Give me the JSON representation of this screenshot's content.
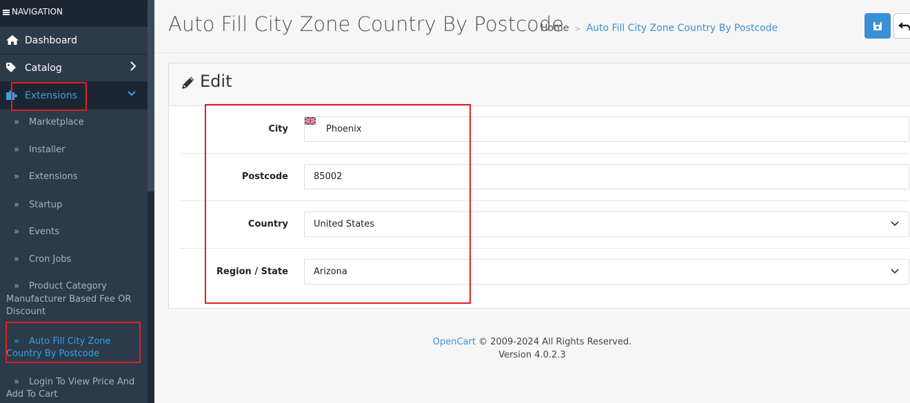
{
  "nav": {
    "header": "NAVIGATION",
    "items": [
      {
        "label": "Dashboard",
        "icon": "home-icon"
      },
      {
        "label": "Catalog",
        "icon": "tag-icon"
      },
      {
        "label": "Extensions",
        "icon": "puzzle-icon"
      }
    ],
    "submenu": [
      "Marketplace",
      "Installer",
      "Extensions",
      "Startup",
      "Events",
      "Cron Jobs",
      "Product Category Manufacturer Based Fee OR Discount",
      "Auto Fill City Zone Country By Postcode",
      "Login To View Price And Add To Cart"
    ]
  },
  "header": {
    "title": "Auto Fill City Zone Country By Postcode",
    "breadcrumb": {
      "home": "Home",
      "current": "Auto Fill City Zone Country By Postcode"
    }
  },
  "card": {
    "title": "Edit",
    "fields": [
      {
        "label": "City",
        "value": "Phoenix"
      },
      {
        "label": "Postcode",
        "value": "85002"
      },
      {
        "label": "Country",
        "value": "United States"
      },
      {
        "label": "Region / State",
        "value": "Arizona"
      }
    ]
  },
  "footer": {
    "brand": "OpenCart",
    "copyright": "© 2009-2024 All Rights Reserved.",
    "version": "Version 4.0.2.3"
  },
  "colors": {
    "accent": "#3c9fe2",
    "sidebar": "#2b3b4a",
    "highlight": "#e01e24"
  }
}
